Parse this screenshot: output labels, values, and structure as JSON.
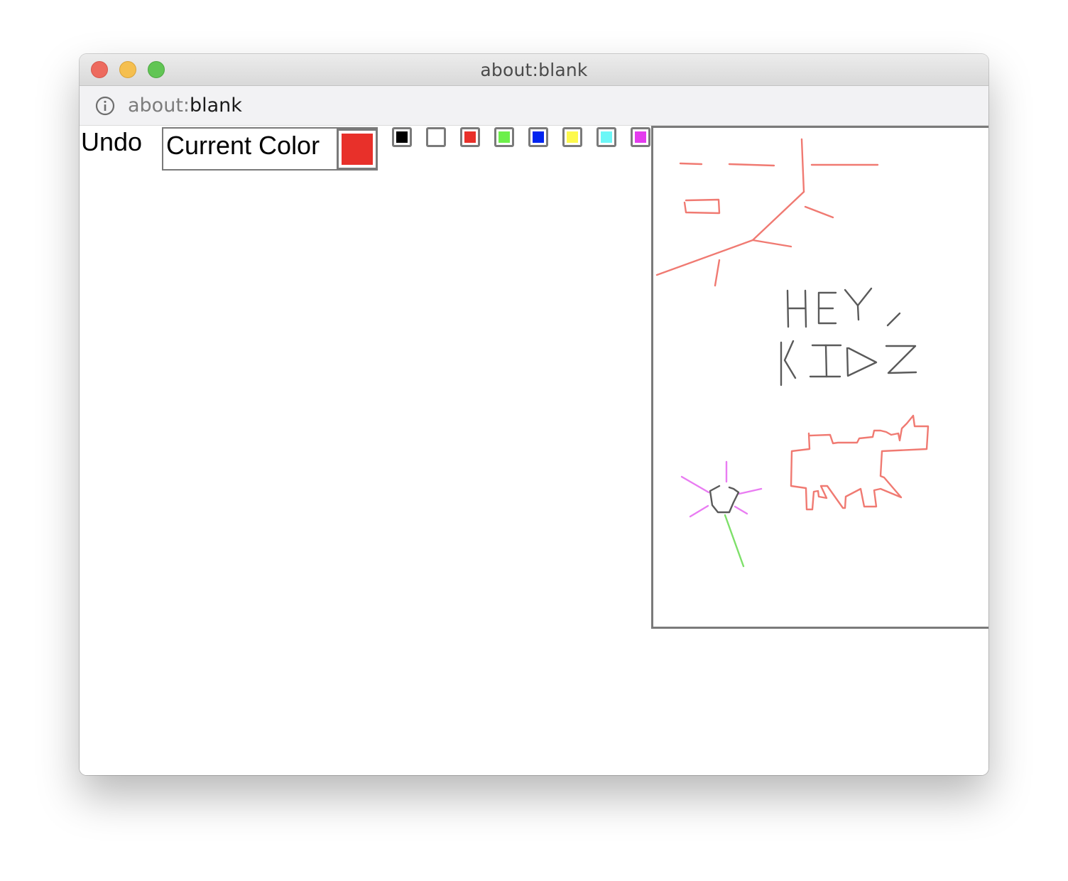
{
  "window": {
    "title": "about:blank"
  },
  "address_bar": {
    "scheme": "about:",
    "rest": "blank"
  },
  "toolbar": {
    "undo_label": "Undo",
    "current_color_label": "Current Color",
    "current_color": "#e8302a"
  },
  "palette": {
    "colors": [
      {
        "name": "black",
        "hex": "#000000"
      },
      {
        "name": "white",
        "hex": "#ffffff"
      },
      {
        "name": "red",
        "hex": "#e8302a"
      },
      {
        "name": "green",
        "hex": "#6cf04a"
      },
      {
        "name": "blue",
        "hex": "#0024f0"
      },
      {
        "name": "yellow",
        "hex": "#fdf94c"
      },
      {
        "name": "cyan",
        "hex": "#6cf7f7"
      },
      {
        "name": "magenta",
        "hex": "#e43bee"
      }
    ]
  },
  "drawing": {
    "stroke_colors": {
      "red": "#f07a72",
      "gray": "#5a5a5a",
      "magenta": "#e97cf2",
      "green": "#7ee06a"
    }
  }
}
